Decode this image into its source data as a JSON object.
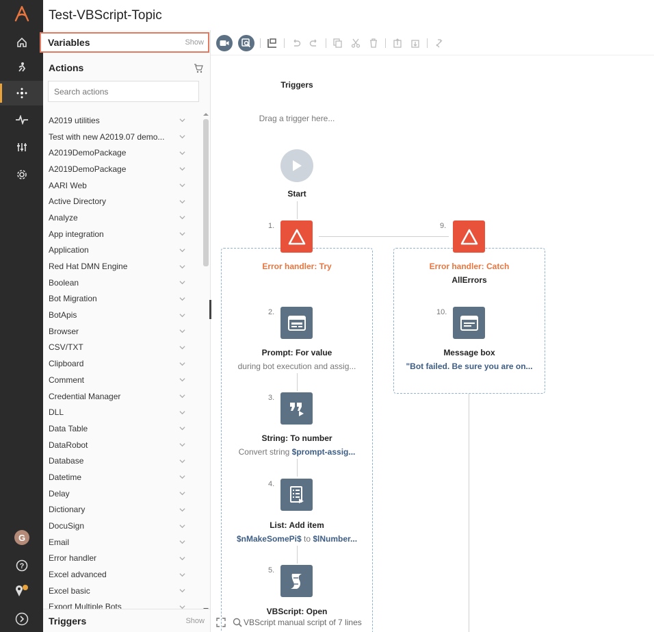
{
  "header": {
    "title": "Test-VBScript-Topic"
  },
  "rail": {
    "logo": "automation-anywhere-logo",
    "items": [
      "home-icon",
      "bot-runner-icon",
      "automation-icon",
      "activity-icon",
      "manage-icon",
      "settings-icon"
    ],
    "avatar_letter": "G",
    "bottom_items": [
      "help-icon",
      "location-badge-icon",
      "expand-icon"
    ]
  },
  "panel": {
    "variables_label": "Variables",
    "variables_show": "Show",
    "actions_label": "Actions",
    "search_placeholder": "Search actions",
    "actions": [
      "A2019 utilities",
      "Test with new A2019.07 demo...",
      "A2019DemoPackage",
      "A2019DemoPackage",
      "AARI Web",
      "Active Directory",
      "Analyze",
      "App integration",
      "Application",
      "Red Hat DMN Engine",
      "Boolean",
      "Bot Migration",
      "BotApis",
      "Browser",
      "CSV/TXT",
      "Clipboard",
      "Comment",
      "Credential Manager",
      "DLL",
      "Data Table",
      "DataRobot",
      "Database",
      "Datetime",
      "Delay",
      "Dictionary",
      "DocuSign",
      "Email",
      "Error handler",
      "Excel advanced",
      "Excel basic",
      "Export Multiple Bots"
    ],
    "triggers_label": "Triggers",
    "triggers_show": "Show"
  },
  "canvas": {
    "triggers_heading": "Triggers",
    "drag_trigger": "Drag a trigger here...",
    "start_label": "Start",
    "nodes": [
      {
        "num": "1.",
        "title": "Error handler: Try"
      },
      {
        "num": "2.",
        "title": "Prompt: For value",
        "desc": "during bot execution and assig..."
      },
      {
        "num": "3.",
        "title": "String: To number",
        "desc_prefix": "Convert string ",
        "desc_var": "$prompt-assig..."
      },
      {
        "num": "4.",
        "title": "List: Add item",
        "var1": "$nMakeSomePi$",
        "mid": " to ",
        "var2": "$lNumber..."
      },
      {
        "num": "5.",
        "title": "VBScript: Open",
        "desc": "VBScript manual script of 7 lines"
      },
      {
        "num": "9.",
        "title": "Error handler: Catch",
        "sub": "AllErrors"
      },
      {
        "num": "10.",
        "title": "Message box",
        "desc": "\"Bot failed. Be sure you are on..."
      }
    ]
  },
  "colors": {
    "accent_orange": "#e8753f",
    "node_red": "#e8513a",
    "node_slate": "#5d7185",
    "highlight_border": "#e07b62"
  }
}
